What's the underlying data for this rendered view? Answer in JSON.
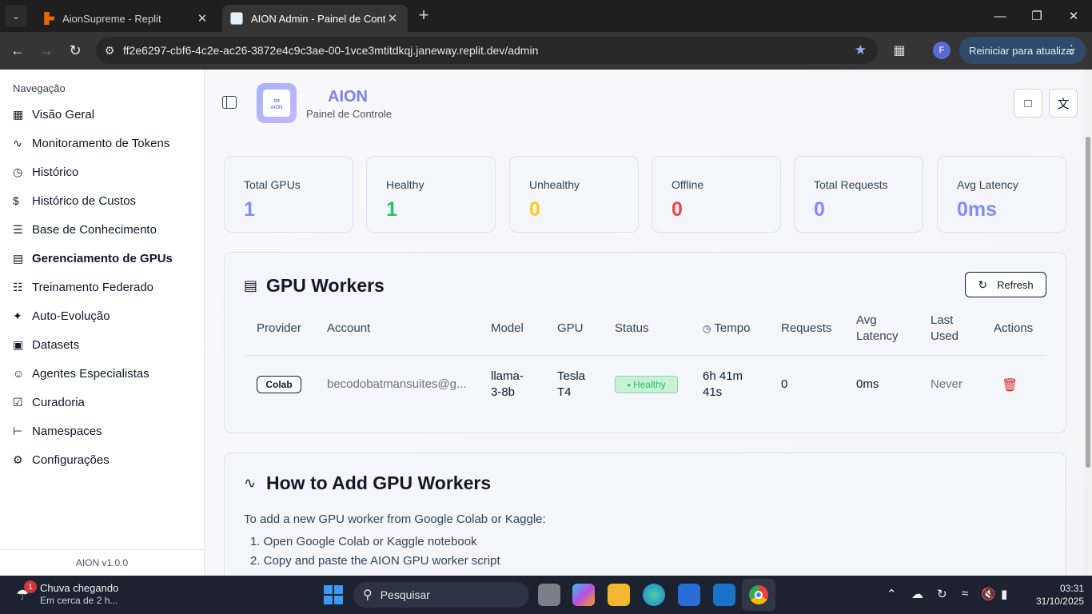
{
  "browser": {
    "tabs": [
      {
        "title": "AionSupreme - Replit",
        "active": false
      },
      {
        "title": "AION Admin - Painel de Controle",
        "active": true
      }
    ],
    "url": "ff2e6297-cbf6-4c2e-ac26-3872e4c9c3ae-00-1vce3mtitdkqj.janeway.replit.dev/admin",
    "profile_initial": "F",
    "update_label": "Reiniciar para atualizar"
  },
  "sidebar": {
    "heading": "Navegação",
    "items": [
      {
        "label": "Visão Geral",
        "icon": "grid-icon"
      },
      {
        "label": "Monitoramento de Tokens",
        "icon": "activity-icon"
      },
      {
        "label": "Histórico",
        "icon": "clock-icon"
      },
      {
        "label": "Histórico de Custos",
        "icon": "dollar-icon"
      },
      {
        "label": "Base de Conhecimento",
        "icon": "database-icon"
      },
      {
        "label": "Gerenciamento de GPUs",
        "icon": "server-icon"
      },
      {
        "label": "Treinamento Federado",
        "icon": "network-icon"
      },
      {
        "label": "Auto-Evolução",
        "icon": "sparkles-icon"
      },
      {
        "label": "Datasets",
        "icon": "file-icon"
      },
      {
        "label": "Agentes Especialistas",
        "icon": "users-icon"
      },
      {
        "label": "Curadoria",
        "icon": "clipboard-check-icon"
      },
      {
        "label": "Namespaces",
        "icon": "tree-icon"
      },
      {
        "label": "Configurações",
        "icon": "gear-icon"
      }
    ],
    "active_index": 5,
    "version": "AION v1.0.0"
  },
  "header": {
    "brand": "AION",
    "subtitle": "Painel de Controle",
    "logo_text": "AION"
  },
  "stats": [
    {
      "label": "Total GPUs",
      "value": "1",
      "color": "#818cf8"
    },
    {
      "label": "Healthy",
      "value": "1",
      "color": "#22c55e"
    },
    {
      "label": "Unhealthy",
      "value": "0",
      "color": "#facc15"
    },
    {
      "label": "Offline",
      "value": "0",
      "color": "#ef4444"
    },
    {
      "label": "Total Requests",
      "value": "0",
      "color": "#818cf8"
    },
    {
      "label": "Avg Latency",
      "value": "0ms",
      "color": "#818cf8"
    }
  ],
  "workers": {
    "title": "GPU Workers",
    "refresh_label": "Refresh",
    "columns": [
      "Provider",
      "Account",
      "Model",
      "GPU",
      "Status",
      "Tempo",
      "Requests",
      "Avg Latency",
      "Last Used",
      "Actions"
    ],
    "rows": [
      {
        "provider": "Colab",
        "account": "becodobatmansuites@g...",
        "model": "llama-3-8b",
        "gpu": "Tesla T4",
        "status": "Healthy",
        "tempo": "6h 41m 41s",
        "requests": "0",
        "latency": "0ms",
        "last_used": "Never"
      }
    ]
  },
  "howto": {
    "title": "How to Add GPU Workers",
    "intro": "To add a new GPU worker from Google Colab or Kaggle:",
    "steps": [
      "1. Open Google Colab or Kaggle notebook",
      "2. Copy and paste the AION GPU worker script"
    ]
  },
  "taskbar": {
    "weather_title": "Chuva chegando",
    "weather_sub": "Em cerca de 2 h...",
    "weather_badge": "1",
    "search_placeholder": "Pesquisar",
    "time": "03:31",
    "date": "31/10/2025"
  }
}
